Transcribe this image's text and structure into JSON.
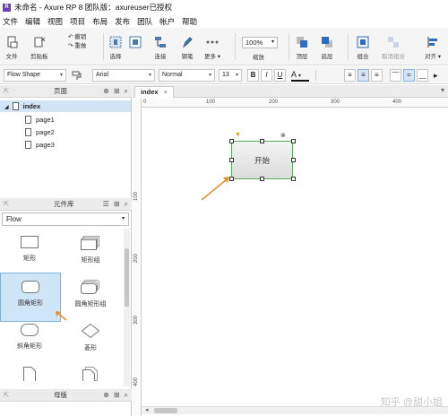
{
  "window": {
    "title": "未命名 - Axure RP 8 团队版：axureuser已授权",
    "logo_glyph": "R"
  },
  "menu": [
    "文件",
    "编辑",
    "视图",
    "项目",
    "布局",
    "发布",
    "团队",
    "帐户",
    "帮助"
  ],
  "toolbar": {
    "file": "文件",
    "clipboard": "剪贴板",
    "undo": "撤销",
    "redo": "重做",
    "select": "选择",
    "connect": "连接",
    "pen": "钢笔",
    "more": "更多",
    "zoom_value": "100%",
    "zoom_label": "缩放",
    "top": "顶层",
    "bottom": "底层",
    "group": "组合",
    "ungroup": "取消组合",
    "align": "对齐"
  },
  "format": {
    "shape_type": "Flow Shape",
    "font": "Arial",
    "weight": "Normal",
    "size": "13",
    "bold": "B",
    "italic": "I",
    "underline": "U",
    "color": "A"
  },
  "pages": {
    "title": "页面",
    "items": [
      {
        "label": "index"
      },
      {
        "label": "page1"
      },
      {
        "label": "page2"
      },
      {
        "label": "page3"
      }
    ]
  },
  "library": {
    "title": "元件库",
    "selected": "Flow",
    "widgets": [
      {
        "label": "矩形"
      },
      {
        "label": "矩形组"
      },
      {
        "label": "圆角矩形"
      },
      {
        "label": "圆角矩形组"
      },
      {
        "label": "斜角矩形"
      },
      {
        "label": "菱形"
      }
    ]
  },
  "masters": {
    "title": "母版"
  },
  "canvas": {
    "tab": "index",
    "ruler_h": [
      "0",
      "100",
      "200",
      "300",
      "400"
    ],
    "ruler_v": [
      "100",
      "200",
      "300",
      "400"
    ],
    "shape_text": "开始"
  },
  "watermark": "知乎 @甜小姐"
}
